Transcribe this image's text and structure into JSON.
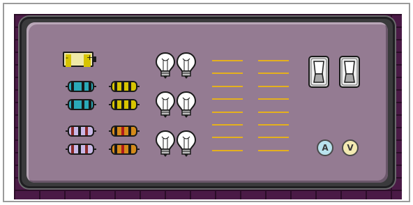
{
  "parts": {
    "battery": {
      "name": "battery",
      "minus": "-",
      "plus": "+"
    },
    "resistors": [
      {
        "bands": [
          "#1a1a1a",
          "#2aa9b8",
          "#2aa9b8",
          "#1a1a1a",
          "#2aa9b8",
          "#1a1a1a"
        ],
        "body": "#2aa9b8"
      },
      {
        "bands": [
          "#1a1a1a",
          "#d7c400",
          "#1a1a1a",
          "#d7c400",
          "#1a1a1a",
          "#d7c400"
        ],
        "body": "#d7c400"
      },
      {
        "bands": [
          "#1a1a1a",
          "#2aa9b8",
          "#2aa9b8",
          "#1a1a1a",
          "#2aa9b8",
          "#1a1a1a"
        ],
        "body": "#2aa9b8"
      },
      {
        "bands": [
          "#1a1a1a",
          "#d7c400",
          "#1a1a1a",
          "#d7c400",
          "#1a1a1a",
          "#d7c400"
        ],
        "body": "#d7c400"
      },
      {
        "bands": [
          "#8a2a2a",
          "#c9b9e8",
          "#1a1a1a",
          "#c9b9e8",
          "#8a2a2a",
          "#c9b9e8"
        ],
        "body": "#c9b9e8"
      },
      {
        "bands": [
          "#1a1a1a",
          "#d48a1a",
          "#b01a1a",
          "#d48a1a",
          "#1a1a1a",
          "#d48a1a"
        ],
        "body": "#d48a1a"
      },
      {
        "bands": [
          "#8a2a2a",
          "#c9b9e8",
          "#1a1a1a",
          "#c9b9e8",
          "#8a2a2a",
          "#c9b9e8"
        ],
        "body": "#c9b9e8"
      },
      {
        "bands": [
          "#1a1a1a",
          "#d48a1a",
          "#b01a1a",
          "#d48a1a",
          "#1a1a1a",
          "#d48a1a"
        ],
        "body": "#d48a1a"
      }
    ],
    "bulb_count": 6,
    "wire_count": 16,
    "switch_count": 2,
    "ammeter": {
      "label": "A",
      "color": "#b9e3ee"
    },
    "voltmeter": {
      "label": "V",
      "color": "#f3eab2"
    }
  },
  "colors": {
    "board": "#947b92",
    "frame": "#3a3a3c",
    "brick": "#4a1a46",
    "wire": "#e4b01e"
  }
}
